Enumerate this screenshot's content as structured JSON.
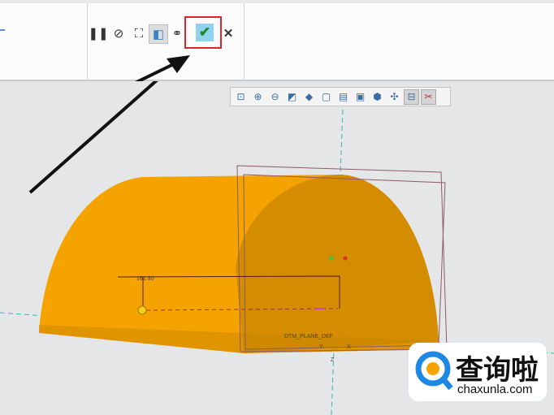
{
  "ribbon": {
    "buttons": [
      {
        "icon": "pause-icon",
        "glyph": "❚❚"
      },
      {
        "icon": "no-icon",
        "glyph": "⊘"
      },
      {
        "icon": "feature-preview-icon",
        "glyph": "⛶"
      },
      {
        "icon": "verify-icon",
        "glyph": "◧"
      },
      {
        "icon": "glasses-icon",
        "glyph": "⚭"
      }
    ],
    "ok_glyph": "✔",
    "cancel_glyph": "✕"
  },
  "view_toolbar": [
    {
      "icon": "refit-icon",
      "glyph": "⊡"
    },
    {
      "icon": "zoom-in-icon",
      "glyph": "⊕"
    },
    {
      "icon": "zoom-out-icon",
      "glyph": "⊖"
    },
    {
      "icon": "repaint-icon",
      "glyph": "◩"
    },
    {
      "icon": "display-style-icon",
      "glyph": "◆"
    },
    {
      "icon": "saved-views-icon",
      "glyph": "▢"
    },
    {
      "icon": "view-manager-icon",
      "glyph": "▤"
    },
    {
      "icon": "perspective-icon",
      "glyph": "▣"
    },
    {
      "icon": "appearance-icon",
      "glyph": "⬢"
    },
    {
      "icon": "datum-display-icon",
      "glyph": "✣"
    },
    {
      "icon": "annotation-display-icon",
      "glyph": "⊟"
    },
    {
      "icon": "spin-center-icon",
      "glyph": "✂"
    }
  ],
  "model": {
    "dimension": "161.80",
    "axis_y": "Y",
    "axis_x": "X",
    "axis_z": "Z",
    "plane_label": "DTM_PLANE_DEF"
  },
  "colors": {
    "body": "#f5a300",
    "body_dark": "#d48c00",
    "accent": "#d9262c"
  },
  "watermark": {
    "text": "查询啦",
    "url": "chaxunla.com"
  }
}
